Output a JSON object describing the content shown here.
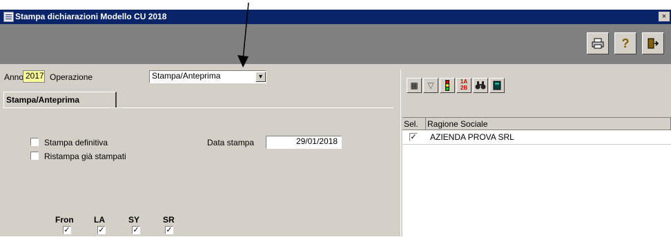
{
  "window": {
    "title": "Stampa dichiarazioni Modello CU 2018",
    "close_label": "×"
  },
  "toolbar": {
    "buttons": [
      {
        "name": "print",
        "glyph": "🖶"
      },
      {
        "name": "help",
        "glyph": "?"
      },
      {
        "name": "exit",
        "glyph": "⇥"
      }
    ]
  },
  "form": {
    "anno_label": "Anno:",
    "anno_value": "2017",
    "operazione_label": "Operazione",
    "operazione_value": "Stampa/Anteprima",
    "dropdown_glyph": "▾",
    "tab_label": "Stampa/Anteprima",
    "stampa_definitiva": {
      "label": "Stampa definitiva",
      "checked": false
    },
    "ristampa": {
      "label": "Ristampa già stampati",
      "checked": false
    },
    "data_stampa_label": "Data stampa",
    "data_stampa_value": "29/01/2018",
    "flags": [
      {
        "label": "Fron",
        "checked": true
      },
      {
        "label": "LA",
        "checked": true
      },
      {
        "label": "SY",
        "checked": true
      },
      {
        "label": "SR",
        "checked": true
      }
    ]
  },
  "right_toolbar": {
    "icons": [
      "grid",
      "filter",
      "traffic-light",
      "sort",
      "binoculars",
      "book"
    ]
  },
  "grid": {
    "columns": [
      "Sel.",
      "Ragione Sociale"
    ],
    "rows": [
      {
        "selected": true,
        "ragione_sociale": "AZIENDA PROVA SRL"
      }
    ]
  },
  "colors": {
    "titlebar": "#0a246a",
    "window_bg": "#d4d0c8",
    "toolbar_bg": "#808080",
    "anno_highlight": "#ffff99"
  }
}
